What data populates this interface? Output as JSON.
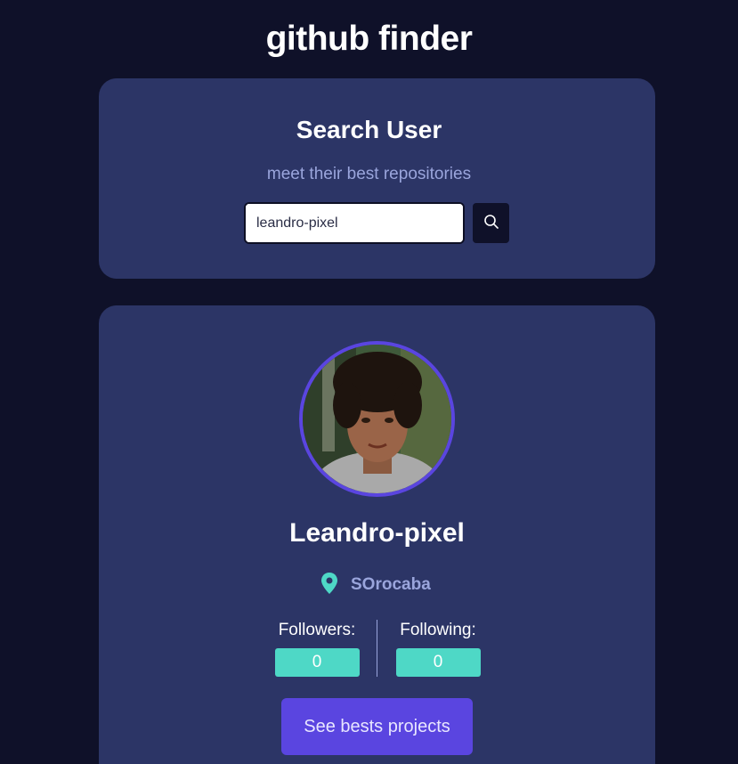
{
  "app": {
    "title": "github finder"
  },
  "search": {
    "title": "Search User",
    "subtitle": "meet their best repositories",
    "input_value": "leandro-pixel",
    "button_icon": "search-icon"
  },
  "profile": {
    "name": "Leandro-pixel",
    "location": "SOrocaba",
    "location_icon": "map-pin-icon",
    "followers_label": "Followers:",
    "followers_count": "0",
    "following_label": "Following:",
    "following_count": "0",
    "projects_button_label": "See bests projects"
  },
  "colors": {
    "background": "#0f1129",
    "card": "#2c3566",
    "accent": "#5a45e0",
    "teal": "#4ed8c6",
    "muted_text": "#9aa5dc"
  }
}
